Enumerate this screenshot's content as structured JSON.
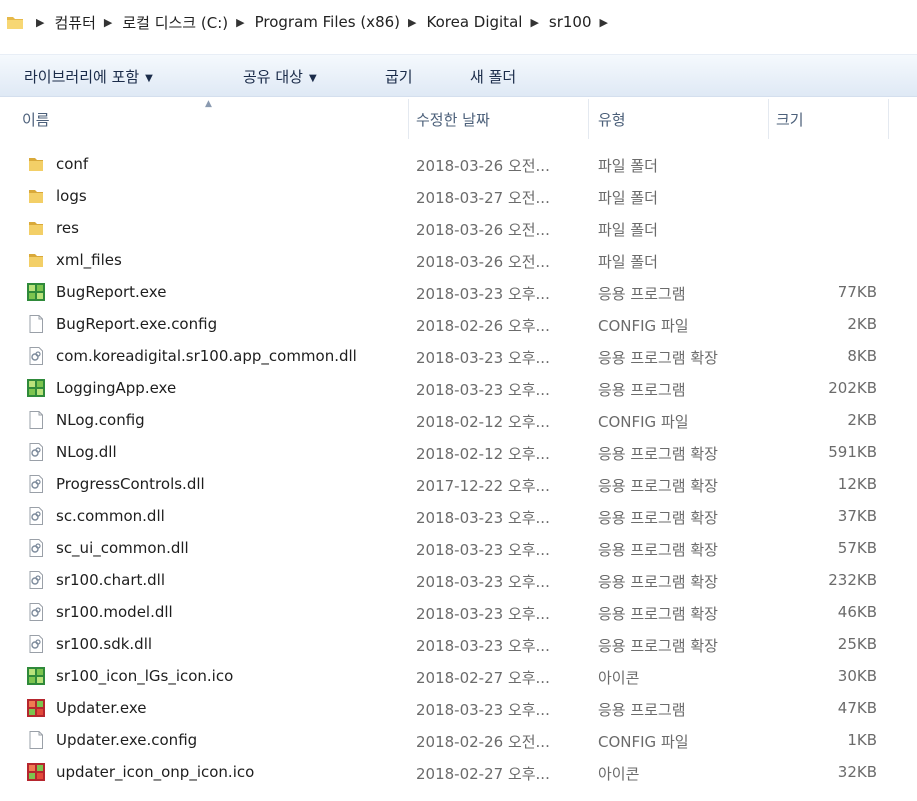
{
  "address": {
    "crumbs": [
      "컴퓨터",
      "로컬 디스크 (C:)",
      "Program Files (x86)",
      "Korea Digital",
      "sr100"
    ]
  },
  "toolbar": {
    "library": "라이브러리에 포함",
    "share": "공유 대상",
    "burn": "굽기",
    "new_folder": "새 폴더"
  },
  "columns": {
    "name": "이름",
    "date": "수정한 날짜",
    "type": "유형",
    "size": "크기"
  },
  "files": [
    {
      "name": "conf",
      "date": "2018-03-26 오전...",
      "type": "파일 폴더",
      "size": "",
      "icon": "folder-icon"
    },
    {
      "name": "logs",
      "date": "2018-03-27 오전...",
      "type": "파일 폴더",
      "size": "",
      "icon": "folder-icon"
    },
    {
      "name": "res",
      "date": "2018-03-26 오전...",
      "type": "파일 폴더",
      "size": "",
      "icon": "folder-icon"
    },
    {
      "name": "xml_files",
      "date": "2018-03-26 오전...",
      "type": "파일 폴더",
      "size": "",
      "icon": "folder-icon"
    },
    {
      "name": "BugReport.exe",
      "date": "2018-03-23 오후...",
      "type": "응용 프로그램",
      "size": "77KB",
      "icon": "app-green-icon"
    },
    {
      "name": "BugReport.exe.config",
      "date": "2018-02-26 오후...",
      "type": "CONFIG 파일",
      "size": "2KB",
      "icon": "blank-file-icon"
    },
    {
      "name": "com.koreadigital.sr100.app_common.dll",
      "date": "2018-03-23 오후...",
      "type": "응용 프로그램 확장",
      "size": "8KB",
      "icon": "dll-icon"
    },
    {
      "name": "LoggingApp.exe",
      "date": "2018-03-23 오후...",
      "type": "응용 프로그램",
      "size": "202KB",
      "icon": "app-green-icon"
    },
    {
      "name": "NLog.config",
      "date": "2018-02-12 오후...",
      "type": "CONFIG 파일",
      "size": "2KB",
      "icon": "blank-file-icon"
    },
    {
      "name": "NLog.dll",
      "date": "2018-02-12 오후...",
      "type": "응용 프로그램 확장",
      "size": "591KB",
      "icon": "dll-icon"
    },
    {
      "name": "ProgressControls.dll",
      "date": "2017-12-22 오후...",
      "type": "응용 프로그램 확장",
      "size": "12KB",
      "icon": "dll-icon"
    },
    {
      "name": "sc.common.dll",
      "date": "2018-03-23 오후...",
      "type": "응용 프로그램 확장",
      "size": "37KB",
      "icon": "dll-icon"
    },
    {
      "name": "sc_ui_common.dll",
      "date": "2018-03-23 오후...",
      "type": "응용 프로그램 확장",
      "size": "57KB",
      "icon": "dll-icon"
    },
    {
      "name": "sr100.chart.dll",
      "date": "2018-03-23 오후...",
      "type": "응용 프로그램 확장",
      "size": "232KB",
      "icon": "dll-icon"
    },
    {
      "name": "sr100.model.dll",
      "date": "2018-03-23 오후...",
      "type": "응용 프로그램 확장",
      "size": "46KB",
      "icon": "dll-icon"
    },
    {
      "name": "sr100.sdk.dll",
      "date": "2018-03-23 오후...",
      "type": "응용 프로그램 확장",
      "size": "25KB",
      "icon": "dll-icon"
    },
    {
      "name": "sr100_icon_lGs_icon.ico",
      "date": "2018-02-27 오후...",
      "type": "아이콘",
      "size": "30KB",
      "icon": "app-green-icon"
    },
    {
      "name": "Updater.exe",
      "date": "2018-03-23 오후...",
      "type": "응용 프로그램",
      "size": "47KB",
      "icon": "app-red-icon"
    },
    {
      "name": "Updater.exe.config",
      "date": "2018-02-26 오전...",
      "type": "CONFIG 파일",
      "size": "1KB",
      "icon": "blank-file-icon"
    },
    {
      "name": "updater_icon_onp_icon.ico",
      "date": "2018-02-27 오후...",
      "type": "아이콘",
      "size": "32KB",
      "icon": "app-red-icon"
    }
  ]
}
